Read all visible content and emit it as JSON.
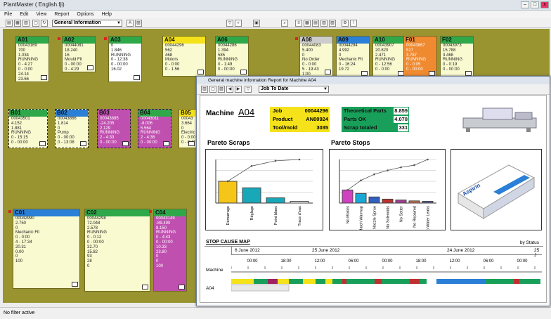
{
  "window": {
    "title": "PlantMaster ( English.fji)"
  },
  "menu": [
    "File",
    "Edit",
    "View",
    "Report",
    "Options",
    "Help"
  ],
  "toolbar": {
    "view_select": "General Information"
  },
  "machines": [
    {
      "id": "A01",
      "hdr": "#2fa84a",
      "style": "",
      "lines": [
        "00043169",
        "700",
        "1.034",
        "RUNNING",
        "0 - 4:27",
        "0 - 0:00",
        "24.14",
        "23.66"
      ]
    },
    {
      "id": "A02",
      "hdr": "#2fa84a",
      "style": "",
      "lines": [
        "00044081",
        "18.240",
        "16",
        "Mould Flt",
        "0 - 00:00",
        "0 - 4:29"
      ]
    },
    {
      "id": "A03",
      "hdr": "#2fa84a",
      "style": "white",
      "lines": [
        "0",
        "1.846",
        "RUNNING",
        "0 - 12:38",
        "0 - 00:00",
        "16.02"
      ]
    },
    {
      "id": "A04",
      "hdr": "#f5e21a",
      "style": "",
      "lines": [
        "00044296",
        "562",
        "468",
        "Motors",
        "0 - 0:00",
        "0 - 1:56"
      ]
    },
    {
      "id": "A06",
      "hdr": "#2fa84a",
      "style": "",
      "lines": [
        "00044286",
        "1.394",
        "585",
        "RUNNING",
        "0 - 1:49",
        "0 - 00:00"
      ]
    },
    {
      "id": "A08",
      "hdr": "#cccccc",
      "style": "",
      "lines": [
        "00044083",
        "5.400",
        "0",
        "No Order",
        "0 - 0:00",
        "5 - 19:43",
        "1:00"
      ]
    },
    {
      "id": "A09",
      "hdr": "#2a7fd6",
      "style": "",
      "lines": [
        "00044294",
        "4.992",
        "0",
        "Mechanic Flt",
        "0 - 16:24",
        "19.72"
      ]
    },
    {
      "id": "A10",
      "hdr": "#2fa84a",
      "style": "",
      "lines": [
        "00043907",
        "20.820",
        "2.471",
        "RUNNING",
        "0 - 12:56",
        "0 - 0:00"
      ]
    },
    {
      "id": "F01",
      "hdr": "#f08a30",
      "style": "orange",
      "lines": [
        "00043867",
        "517",
        "3.787",
        "RUNNING",
        "0 - 0:05",
        "0 - 00:00"
      ]
    },
    {
      "id": "F02",
      "hdr": "#2fa84a",
      "style": "",
      "lines": [
        "00043973",
        "15.788",
        "3.468",
        "RUNNING",
        "0 - 0:19",
        "0 - 00:00"
      ]
    },
    {
      "id": "B01",
      "hdr": "#2fa84a",
      "style": "",
      "lines": [
        "00043501",
        "4.152",
        "1.881",
        "RUNNING",
        "0 - 15:15",
        "0 - 00:00"
      ]
    },
    {
      "id": "B02",
      "hdr": "#2a7fd6",
      "style": "",
      "lines": [
        "00043866",
        "1.814",
        "0",
        "Pump",
        "0 - 00:00",
        "0 - 13:08"
      ]
    },
    {
      "id": "B03",
      "hdr": "#c050b0",
      "style": "pink",
      "lines": [
        "00043885",
        "-24.205",
        "2.129",
        "RUNNING",
        "2 - 4:33",
        "0 - 00:00"
      ]
    },
    {
      "id": "B04",
      "hdr": "#2fa84a",
      "style": "pink",
      "lines": [
        "00043011",
        "-8.006",
        "5.564",
        "RUNNING",
        "2 - 4:36",
        "0 - 00:00"
      ]
    },
    {
      "id": "B05",
      "hdr": "#f5e21a",
      "style": "",
      "lines": [
        "00043",
        "3.664",
        "0",
        "Electric",
        "0 - 0:00",
        "0 - 8:47"
      ]
    },
    {
      "id": "C01",
      "hdr": "#2a7fd6",
      "style": "",
      "lines": [
        "00042990",
        "2.750",
        "0",
        "Mechanic Flt",
        "0 - 0:00",
        "4 - 17:34",
        "20.31",
        "0.00",
        "0",
        "100"
      ]
    },
    {
      "id": "C02",
      "hdr": "#2fa84a",
      "style": "",
      "lines": [
        "00044298",
        "72.048",
        "2.578",
        "RUNNING",
        "0 - 0:12",
        "0 - 00:00",
        "32.70",
        "15.82",
        "93",
        "28",
        "0"
      ]
    },
    {
      "id": "C04",
      "hdr": "#2fa84a",
      "style": "pink",
      "lines": [
        "00043149",
        "-89.490",
        "8.150",
        "RUNNING",
        "0 - 4:43",
        "0 - 00:00",
        "10.33",
        "23.80",
        "0",
        "0",
        "100"
      ]
    }
  ],
  "status": "No filter active",
  "report": {
    "title": "General machine information Report for Machine A04",
    "range": "Job To Date",
    "machine_label": "Machine",
    "machine_id": "A04",
    "job": [
      {
        "k": "Job",
        "v": "00044296"
      },
      {
        "k": "Product",
        "v": "AN00924"
      },
      {
        "k": "Tool/mold",
        "v": "3035"
      }
    ],
    "parts": [
      {
        "k": "Theoretical Parts",
        "v": "8.859"
      },
      {
        "k": "Parts OK",
        "v": "4.078"
      },
      {
        "k": "Scrap totaled",
        "v": "331"
      }
    ],
    "pareto_scraps_title": "Pareto Scraps",
    "pareto_stops_title": "Pareto Stops",
    "stop_map_title": "STOP CAUSE MAP",
    "by_status": "by Status",
    "dates": [
      "6 June 2012",
      "25 June 2012",
      "24 June 2012",
      "25 J"
    ],
    "times": [
      "00:00",
      "18:00",
      "12:00",
      "06:00",
      "00:00",
      "18:00",
      "12:00",
      "06:00",
      "00:00"
    ],
    "row_machine": "Machine",
    "row_a04": "A04",
    "package_text": "Aspirin"
  },
  "chart_data": [
    {
      "type": "bar",
      "title": "Pareto Scraps",
      "categories": [
        "Démarrage",
        "Réglage",
        "Point blanc",
        "Trace d'eau"
      ],
      "values": [
        50,
        35,
        12,
        4
      ],
      "cumulative": [
        50,
        85,
        97,
        100
      ],
      "colors": [
        "#f5c518",
        "#18a8b8",
        "#18a8b8",
        "#ffffff"
      ]
    },
    {
      "type": "bar",
      "title": "Pareto Stops",
      "categories": [
        "No Motors",
        "No Match Warmup",
        "No Nozzle Spruе",
        "No Solenoids",
        "No Setter",
        "No Repaired",
        "No Water Leaks"
      ],
      "values": [
        30,
        22,
        14,
        9,
        7,
        5,
        4
      ],
      "cumulative": [
        30,
        52,
        66,
        75,
        82,
        87,
        100
      ],
      "colors": [
        "#d040c0",
        "#18a8d8",
        "#3060c0",
        "#c03030",
        "#a04090",
        "#d07050",
        "#6060a0"
      ]
    }
  ]
}
